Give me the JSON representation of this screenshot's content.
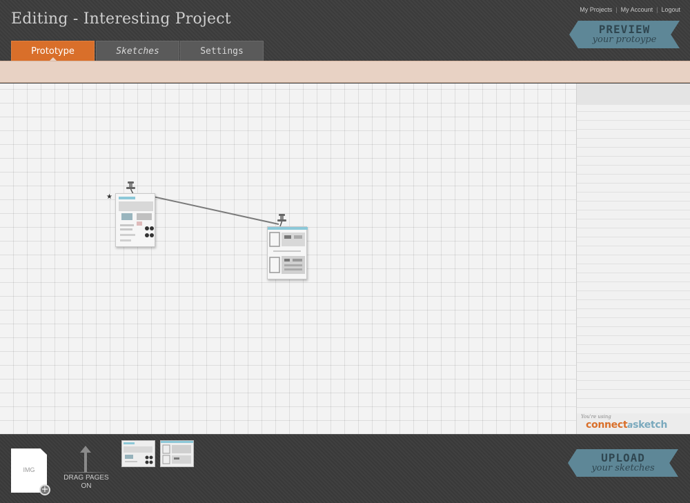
{
  "header": {
    "title": "Editing - Interesting Project",
    "links": [
      "My Projects",
      "My Account",
      "Logout"
    ],
    "tabs": [
      {
        "label": "Prototype",
        "active": true
      },
      {
        "label": "Sketches",
        "active": false
      },
      {
        "label": "Settings",
        "active": false
      }
    ],
    "preview": {
      "big": "PREVIEW",
      "small": "your protoype"
    }
  },
  "sidebar": {
    "brand_small": "You're using",
    "brand_part1": "connect",
    "brand_part2": "a",
    "brand_part3": "sketch"
  },
  "footer": {
    "img_label": "IMG",
    "drag_line1": "DRAG PAGES",
    "drag_line2": "ON",
    "upload": {
      "big": "UPLOAD",
      "small": "your sketches"
    }
  },
  "colors": {
    "accent_orange": "#d96f2a",
    "ribbon_blue": "#5e8797",
    "strip": "#e8d2c4",
    "header_dark": "#3d3d3d"
  },
  "icons": [
    "pushpin-icon",
    "star-icon",
    "plus-icon",
    "up-arrow-icon"
  ]
}
